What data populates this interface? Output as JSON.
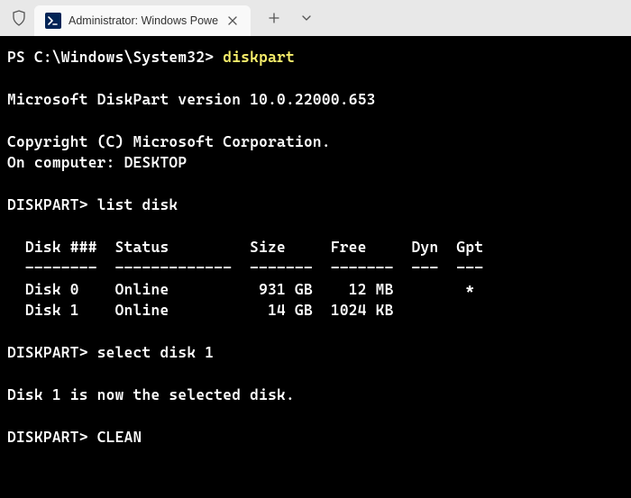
{
  "tab": {
    "title": "Administrator: Windows Powe"
  },
  "terminal": {
    "line1_prompt": "PS C:\\Windows\\System32> ",
    "line1_cmd": "diskpart",
    "line2": "Microsoft DiskPart version 10.0.22000.653",
    "line3": "Copyright (C) Microsoft Corporation.",
    "line4": "On computer: DESKTOP",
    "line5_prompt": "DISKPART> ",
    "line5_cmd": "list disk",
    "table_header": "  Disk ###  Status         Size     Free     Dyn  Gpt",
    "table_divider": "  --------  -------------  -------  -------  ---  ---",
    "table_row0": "  Disk 0    Online          931 GB    12 MB        *",
    "table_row1": "  Disk 1    Online           14 GB  1024 KB",
    "line6_prompt": "DISKPART> ",
    "line6_cmd": "select disk 1",
    "line7": "Disk 1 is now the selected disk.",
    "line8_prompt": "DISKPART> ",
    "line8_cmd": "CLEAN"
  },
  "disk_table": {
    "columns": [
      "Disk ###",
      "Status",
      "Size",
      "Free",
      "Dyn",
      "Gpt"
    ],
    "rows": [
      {
        "disk": "Disk 0",
        "status": "Online",
        "size": "931 GB",
        "free": "12 MB",
        "dyn": "",
        "gpt": "*"
      },
      {
        "disk": "Disk 1",
        "status": "Online",
        "size": "14 GB",
        "free": "1024 KB",
        "dyn": "",
        "gpt": ""
      }
    ]
  }
}
